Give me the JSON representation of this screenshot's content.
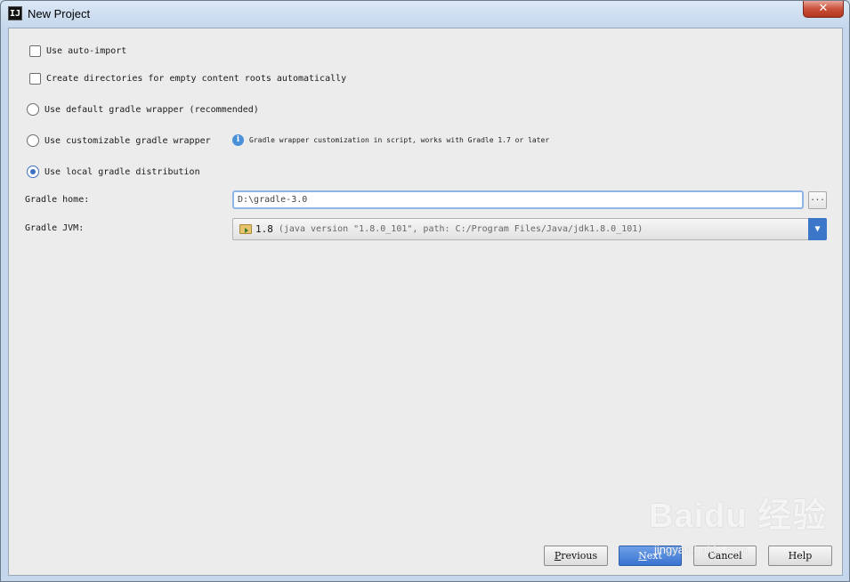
{
  "window": {
    "title": "New Project",
    "app_icon_text": "IJ",
    "close_label": "✕"
  },
  "options": {
    "auto_import": {
      "label": "Use auto-import",
      "checked": false
    },
    "create_dirs": {
      "label": "Create directories for empty content roots automatically",
      "checked": false
    },
    "default_wrapper": {
      "label": "Use default gradle wrapper (recommended)",
      "selected": false
    },
    "custom_wrapper": {
      "label": "Use customizable gradle wrapper",
      "selected": false,
      "hint": "Gradle wrapper customization in script, works with Gradle 1.7 or later"
    },
    "local_distribution": {
      "label": "Use local gradle distribution",
      "selected": true
    }
  },
  "gradle_home": {
    "label": "Gradle home:",
    "value": "D:\\gradle-3.0",
    "browse_label": "..."
  },
  "gradle_jvm": {
    "label": "Gradle JVM:",
    "version": "1.8",
    "detail": "(java version \"1.8.0_101\", path: C:/Program Files/Java/jdk1.8.0_101)",
    "arrow": "▼"
  },
  "buttons": {
    "previous": {
      "mnemonic": "P",
      "rest": "revious"
    },
    "next": {
      "mnemonic": "N",
      "rest": "ext"
    },
    "cancel": {
      "label": "Cancel"
    },
    "help": {
      "label": "Help"
    }
  },
  "watermark": {
    "main": "Baidu 经验",
    "sub": "jingyan.baidu.com"
  },
  "colors": {
    "accent": "#3d6fc1",
    "primary_button": "#3a73d0",
    "close_button": "#c9503a"
  }
}
